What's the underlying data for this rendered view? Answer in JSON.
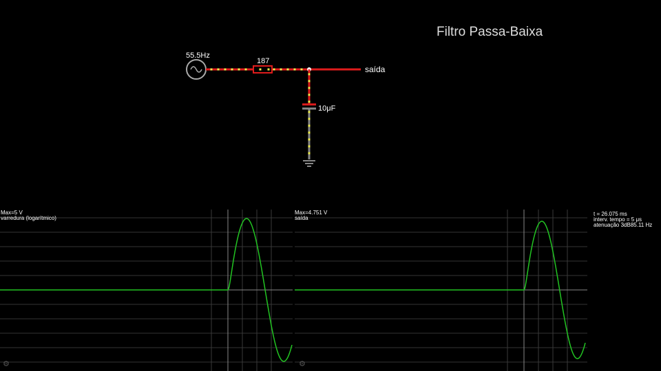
{
  "circuit": {
    "title": "Filtro Passa-Baixa",
    "source_freq": "55.5Hz",
    "resistor_value": "187",
    "capacitor_value": "10μF",
    "output_label": "saída"
  },
  "scopes": [
    {
      "max": "Max=5 V",
      "name": "varredura (logarítmico)"
    },
    {
      "max": "Max=4.751 V",
      "name": "saída"
    }
  ],
  "info": {
    "time": "t = 26.075 ms",
    "timestep": "interv. tempo = 5 μs",
    "cutoff": "atenuação 3dB85.11 Hz"
  },
  "colors": {
    "wire_active": "#e01c1c",
    "current_dot": "#f0f050",
    "wave": "#22c422",
    "grid": "#3a3a3a",
    "grid_bright": "#888888"
  },
  "icons": {
    "settings": "gear-icon"
  }
}
